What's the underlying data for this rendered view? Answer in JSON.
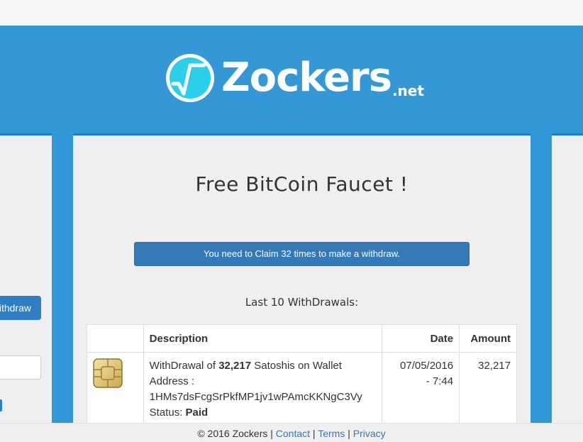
{
  "brand": {
    "name": "Zockers",
    "tld": ".net"
  },
  "sidebar": {
    "withdraw_label": "Withdraw"
  },
  "main": {
    "title": "Free BitCoin Faucet !",
    "notice": "You need to Claim 32 times to make a withdraw.",
    "subtitle": "Last 10 WithDrawals:"
  },
  "table": {
    "headers": [
      "",
      "Description",
      "Date",
      "Amount"
    ],
    "rows": [
      {
        "icon": "bitcoin-chip-icon",
        "desc_prefix": "WithDrawal of ",
        "desc_amount": "32,217",
        "desc_suffix": " Satoshis on Wallet",
        "address_label": "Address :",
        "address": "1HMs7dsFcgSrPkfMP1jv1wPAmcKKNgC3Vy",
        "status_label": "Status: ",
        "status": "Paid",
        "date_line1": "07/05/2016",
        "date_line2": "- 7:44",
        "amount": "32,217"
      }
    ]
  },
  "footer": {
    "copyright": "© 2016 Zockers",
    "sep": "|",
    "links": [
      "Contact",
      "Terms",
      "Privacy"
    ]
  },
  "colors": {
    "header_blue": "#3398d5",
    "button_blue": "#337ab7",
    "logo_cyan": "#2ad0ea"
  }
}
